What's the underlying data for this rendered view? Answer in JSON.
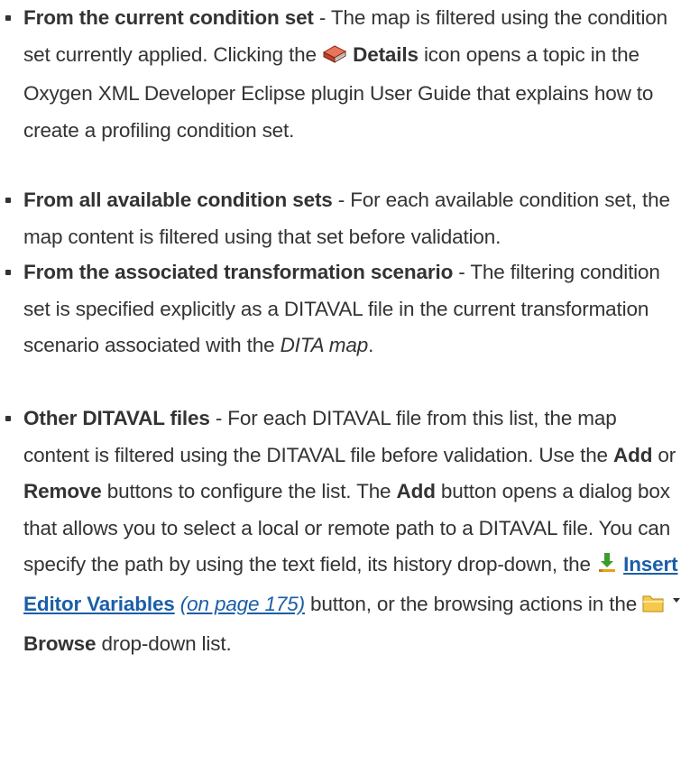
{
  "items": [
    {
      "term": "From the current condition set",
      "part1": " - The map is filtered using the condition set currently applied. Clicking the ",
      "icon": "details-book-icon",
      "ui_label": "Details",
      "part2": " icon opens a topic in the Oxygen XML Developer Eclipse plugin User Guide that explains how to create a profiling condition set."
    },
    {
      "term": "From all available condition sets",
      "part1": " - For each available condition set, the map content is filtered using that set before validation."
    },
    {
      "term": "From the associated transformation scenario",
      "part1": " - The filtering condition set is specified explicitly as a DITAVAL file in the current transformation scenario associated with the ",
      "emph": "DITA map",
      "part2": "."
    },
    {
      "term": "Other DITAVAL files",
      "part1": " - For each DITAVAL file from this list, the map content is filtered using the DITAVAL file before validation. Use the ",
      "add": "Add",
      "or": " or ",
      "remove": "Remove",
      "part2": " buttons to configure the list. The ",
      "add2": "Add",
      "part3": " button opens a dialog box that allows you to select a local or remote path to a DITAVAL file. You can specify the path by using the text field, its history drop-down, the ",
      "insert_icon": "insert-variables-icon",
      "insert_label": "Insert Editor Variables",
      "xref": "(on page 175)",
      "part4": " button, or the browsing actions in the ",
      "browse_icon": "folder-icon",
      "dropdown_icon": "dropdown-arrow-icon",
      "browse_label": "Browse",
      "part5": " drop-down list."
    }
  ]
}
